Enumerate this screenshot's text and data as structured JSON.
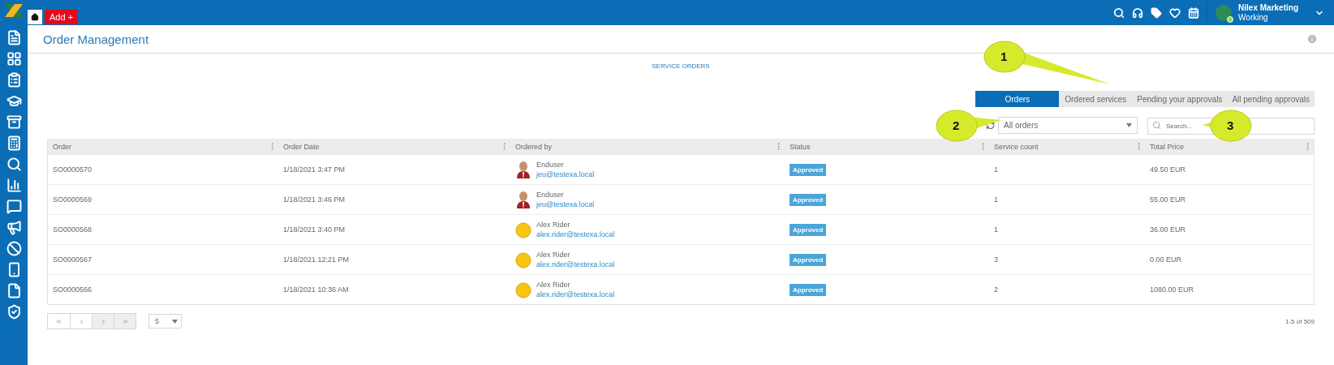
{
  "top_bar": {
    "add_button": "Add +",
    "user": {
      "name": "Nilex Marketing",
      "status": "Working"
    }
  },
  "page_title": "Order Management",
  "section_title": "SERVICE ORDERS",
  "tabs": [
    {
      "label": "Orders",
      "selected": true
    },
    {
      "label": "Ordered services",
      "selected": false
    },
    {
      "label": "Pending your approvals",
      "selected": false
    },
    {
      "label": "All pending approvals",
      "selected": false
    }
  ],
  "filter": {
    "value": "All orders"
  },
  "search": {
    "placeholder": "Search..."
  },
  "table": {
    "columns": [
      "Order",
      "Order Date",
      "Ordered by",
      "Status",
      "Service count",
      "Total Price"
    ],
    "rows": [
      {
        "order": "SO0000570",
        "date": "1/18/2021 3:47 PM",
        "ordered_by": {
          "name": "Enduser",
          "email": "jeu@testexa.local",
          "kind": "person"
        },
        "status": "Approved",
        "service_count": "1",
        "total_price": "49.50 EUR"
      },
      {
        "order": "SO0000569",
        "date": "1/18/2021 3:46 PM",
        "ordered_by": {
          "name": "Enduser",
          "email": "jeu@testexa.local",
          "kind": "person"
        },
        "status": "Approved",
        "service_count": "1",
        "total_price": "55.00 EUR"
      },
      {
        "order": "SO0000568",
        "date": "1/18/2021 3:40 PM",
        "ordered_by": {
          "name": "Alex Rider",
          "email": "alex.rider@testexa.local",
          "kind": "emoji"
        },
        "status": "Approved",
        "service_count": "1",
        "total_price": "36.00 EUR"
      },
      {
        "order": "SO0000567",
        "date": "1/18/2021 12:21 PM",
        "ordered_by": {
          "name": "Alex Rider",
          "email": "alex.rider@testexa.local",
          "kind": "emoji"
        },
        "status": "Approved",
        "service_count": "3",
        "total_price": "0.00 EUR"
      },
      {
        "order": "SO0000566",
        "date": "1/18/2021 10:36 AM",
        "ordered_by": {
          "name": "Alex Rider",
          "email": "alex.rider@testexa.local",
          "kind": "emoji"
        },
        "status": "Approved",
        "service_count": "2",
        "total_price": "1080.00 EUR"
      }
    ]
  },
  "pager": {
    "page_size": "5",
    "summary": "1-5 of 509"
  },
  "callouts": [
    "1",
    "2",
    "3"
  ]
}
